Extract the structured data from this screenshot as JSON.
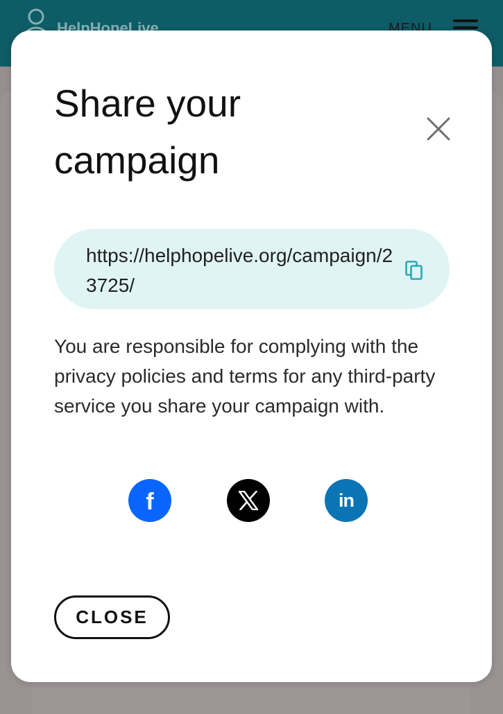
{
  "header": {
    "logo_text": "HelpHopeLive",
    "menu_label": "MENU"
  },
  "modal": {
    "title": "Share your campaign",
    "url": "https://helphopelive.org/campaign/23725/",
    "disclaimer": "You are responsible for complying with the privacy policies and terms for any third-party service you share your campaign with.",
    "share_buttons": [
      {
        "icon": "facebook-icon",
        "label": "f",
        "color": "#0866ff"
      },
      {
        "icon": "x-twitter-icon",
        "color": "#000000"
      },
      {
        "icon": "linkedin-icon",
        "label": "in",
        "color": "#0a74b5"
      }
    ],
    "close_label": "CLOSE"
  },
  "colors": {
    "header_bg": "#0e5c66",
    "url_box_bg": "#e0f4f4",
    "accent": "#2aa7b3"
  }
}
